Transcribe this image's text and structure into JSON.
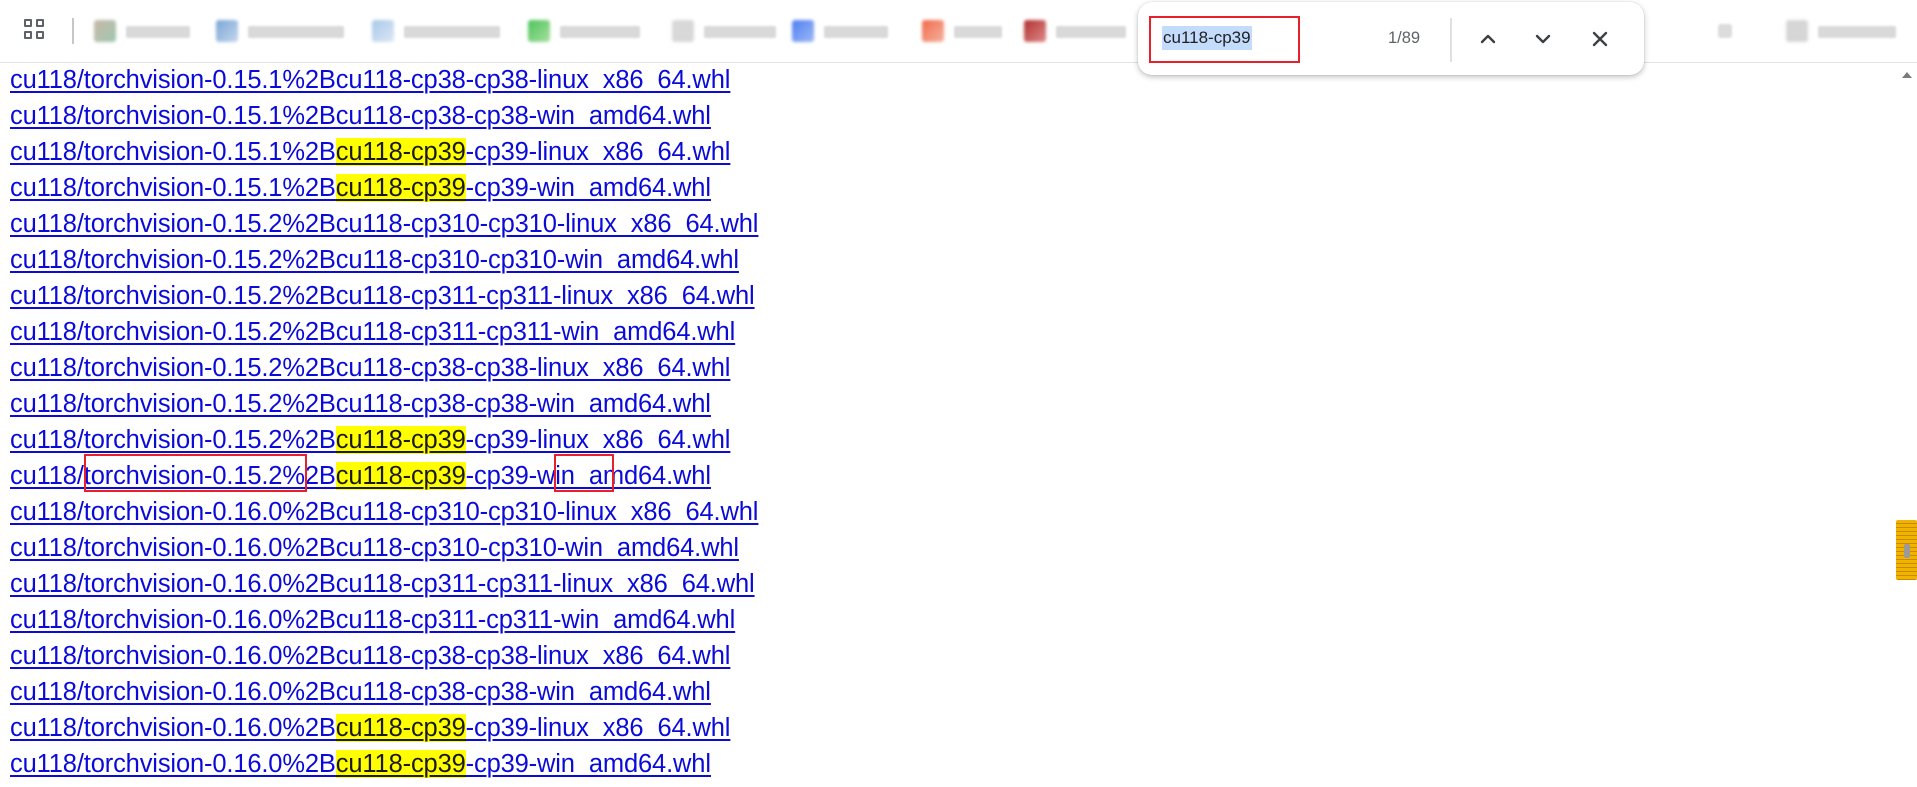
{
  "find_bar": {
    "query": "cu118-cp39",
    "count": "1/89"
  },
  "links": [
    {
      "pre": "cu118/torchvision-0.15.1%2Bcu118-cp38-cp38-linux_x86_64.whl",
      "hl": "",
      "post": ""
    },
    {
      "pre": "cu118/torchvision-0.15.1%2Bcu118-cp38-cp38-win_amd64.whl",
      "hl": "",
      "post": ""
    },
    {
      "pre": "cu118/torchvision-0.15.1%2B",
      "hl": "cu118-cp39",
      "post": "-cp39-linux_x86_64.whl"
    },
    {
      "pre": "cu118/torchvision-0.15.1%2B",
      "hl": "cu118-cp39",
      "post": "-cp39-win_amd64.whl"
    },
    {
      "pre": "cu118/torchvision-0.15.2%2Bcu118-cp310-cp310-linux_x86_64.whl",
      "hl": "",
      "post": ""
    },
    {
      "pre": "cu118/torchvision-0.15.2%2Bcu118-cp310-cp310-win_amd64.whl",
      "hl": "",
      "post": ""
    },
    {
      "pre": "cu118/torchvision-0.15.2%2Bcu118-cp311-cp311-linux_x86_64.whl",
      "hl": "",
      "post": ""
    },
    {
      "pre": "cu118/torchvision-0.15.2%2Bcu118-cp311-cp311-win_amd64.whl",
      "hl": "",
      "post": ""
    },
    {
      "pre": "cu118/torchvision-0.15.2%2Bcu118-cp38-cp38-linux_x86_64.whl",
      "hl": "",
      "post": ""
    },
    {
      "pre": "cu118/torchvision-0.15.2%2Bcu118-cp38-cp38-win_amd64.whl",
      "hl": "",
      "post": ""
    },
    {
      "pre": "cu118/torchvision-0.15.2%2B",
      "hl": "cu118-cp39",
      "post": "-cp39-linux_x86_64.whl"
    },
    {
      "pre": "cu118/torchvision-0.15.2%2B",
      "hl": "cu118-cp39",
      "post": "-cp39-win_amd64.whl"
    },
    {
      "pre": "cu118/torchvision-0.16.0%2Bcu118-cp310-cp310-linux_x86_64.whl",
      "hl": "",
      "post": ""
    },
    {
      "pre": "cu118/torchvision-0.16.0%2Bcu118-cp310-cp310-win_amd64.whl",
      "hl": "",
      "post": ""
    },
    {
      "pre": "cu118/torchvision-0.16.0%2Bcu118-cp311-cp311-linux_x86_64.whl",
      "hl": "",
      "post": ""
    },
    {
      "pre": "cu118/torchvision-0.16.0%2Bcu118-cp311-cp311-win_amd64.whl",
      "hl": "",
      "post": ""
    },
    {
      "pre": "cu118/torchvision-0.16.0%2Bcu118-cp38-cp38-linux_x86_64.whl",
      "hl": "",
      "post": ""
    },
    {
      "pre": "cu118/torchvision-0.16.0%2Bcu118-cp38-cp38-win_amd64.whl",
      "hl": "",
      "post": ""
    },
    {
      "pre": "cu118/torchvision-0.16.0%2B",
      "hl": "cu118-cp39",
      "post": "-cp39-linux_x86_64.whl"
    },
    {
      "pre": "cu118/torchvision-0.16.0%2B",
      "hl": "cu118-cp39",
      "post": "-cp39-win_amd64.whl"
    }
  ],
  "colors": {
    "link": "#0b0bd9",
    "match_highlight": "#ffff00",
    "annotation": "#e8202a"
  },
  "icons": [
    "apps-grid-icon",
    "chevron-up-icon",
    "chevron-down-icon",
    "close-icon",
    "scroll-up-arrow-icon"
  ]
}
